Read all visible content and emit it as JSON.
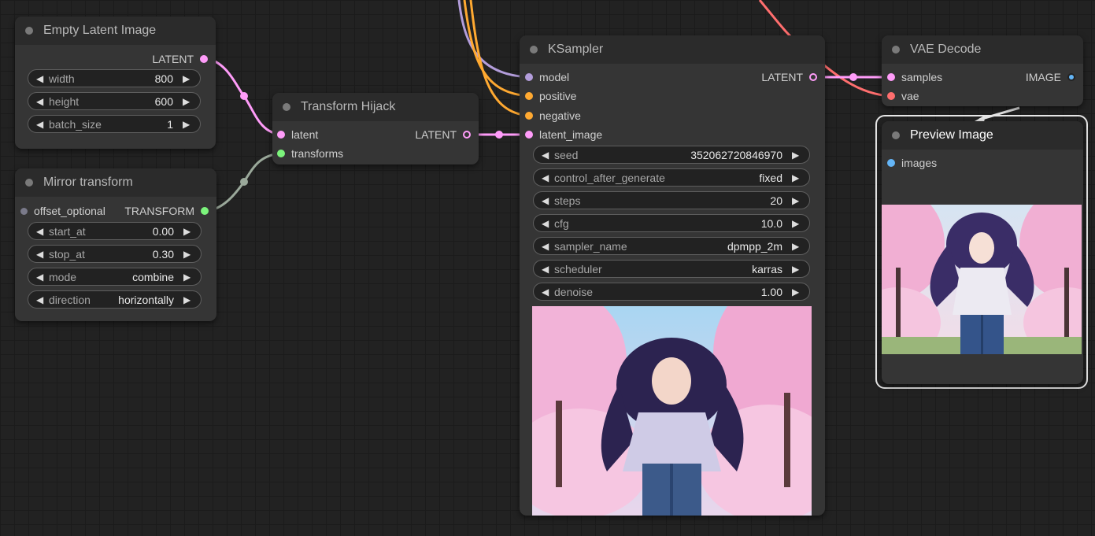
{
  "colors": {
    "latent": "#ff9cf9",
    "transform": "#7cf47c",
    "model": "#b39ddb",
    "conditioning": "#ffa931",
    "vae": "#ff6e6e",
    "image": "#64b5f6",
    "offset": "#7a7a8a"
  },
  "nodes": {
    "empty_latent": {
      "title": "Empty Latent Image",
      "output": "LATENT",
      "widgets": [
        {
          "name": "width",
          "value": "800"
        },
        {
          "name": "height",
          "value": "600"
        },
        {
          "name": "batch_size",
          "value": "1"
        }
      ]
    },
    "mirror": {
      "title": "Mirror transform",
      "input": "offset_optional",
      "output": "TRANSFORM",
      "widgets": [
        {
          "name": "start_at",
          "value": "0.00"
        },
        {
          "name": "stop_at",
          "value": "0.30"
        },
        {
          "name": "mode",
          "value": "combine"
        },
        {
          "name": "direction",
          "value": "horizontally"
        }
      ]
    },
    "hijack": {
      "title": "Transform Hijack",
      "inputs": [
        "latent",
        "transforms"
      ],
      "output": "LATENT"
    },
    "ksampler": {
      "title": "KSampler",
      "inputs": [
        "model",
        "positive",
        "negative",
        "latent_image"
      ],
      "output": "LATENT",
      "widgets": [
        {
          "name": "seed",
          "value": "352062720846970"
        },
        {
          "name": "control_after_generate",
          "value": "fixed"
        },
        {
          "name": "steps",
          "value": "20"
        },
        {
          "name": "cfg",
          "value": "10.0"
        },
        {
          "name": "sampler_name",
          "value": "dpmpp_2m"
        },
        {
          "name": "scheduler",
          "value": "karras"
        },
        {
          "name": "denoise",
          "value": "1.00"
        }
      ]
    },
    "vae_decode": {
      "title": "VAE Decode",
      "inputs": [
        "samples",
        "vae"
      ],
      "output": "IMAGE"
    },
    "preview": {
      "title": "Preview Image",
      "input": "images"
    }
  },
  "icons": {
    "arrow_left": "◀",
    "arrow_right": "▶"
  }
}
